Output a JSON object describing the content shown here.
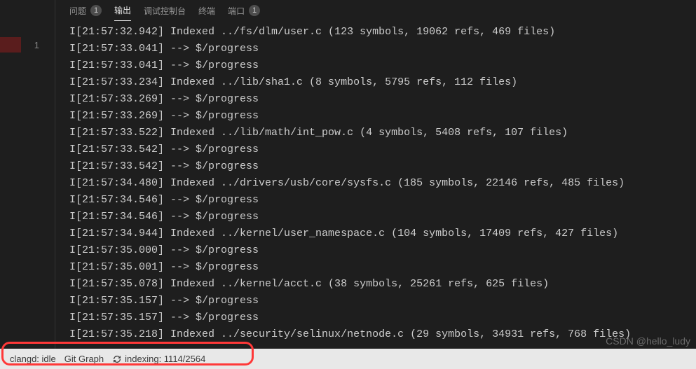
{
  "tabs": {
    "problems": {
      "label": "问题",
      "badge": "1"
    },
    "output": {
      "label": "输出"
    },
    "debug": {
      "label": "调试控制台"
    },
    "terminal": {
      "label": "终端"
    },
    "ports": {
      "label": "端口",
      "badge": "1"
    }
  },
  "gutter": {
    "line_number": "1"
  },
  "output_lines": [
    "I[21:57:32.942] Indexed ../fs/dlm/user.c (123 symbols, 19062 refs, 469 files)",
    "I[21:57:33.041] --> $/progress",
    "I[21:57:33.041] --> $/progress",
    "I[21:57:33.234] Indexed ../lib/sha1.c (8 symbols, 5795 refs, 112 files)",
    "I[21:57:33.269] --> $/progress",
    "I[21:57:33.269] --> $/progress",
    "I[21:57:33.522] Indexed ../lib/math/int_pow.c (4 symbols, 5408 refs, 107 files)",
    "I[21:57:33.542] --> $/progress",
    "I[21:57:33.542] --> $/progress",
    "I[21:57:34.480] Indexed ../drivers/usb/core/sysfs.c (185 symbols, 22146 refs, 485 files)",
    "I[21:57:34.546] --> $/progress",
    "I[21:57:34.546] --> $/progress",
    "I[21:57:34.944] Indexed ../kernel/user_namespace.c (104 symbols, 17409 refs, 427 files)",
    "I[21:57:35.000] --> $/progress",
    "I[21:57:35.001] --> $/progress",
    "I[21:57:35.078] Indexed ../kernel/acct.c (38 symbols, 25261 refs, 625 files)",
    "I[21:57:35.157] --> $/progress",
    "I[21:57:35.157] --> $/progress",
    "I[21:57:35.218] Indexed ../security/selinux/netnode.c (29 symbols, 34931 refs, 768 files)"
  ],
  "statusbar": {
    "clangd": "clangd: idle",
    "gitgraph": "Git Graph",
    "indexing": "indexing: 1114/2564"
  },
  "watermark": "CSDN @hello_ludy"
}
